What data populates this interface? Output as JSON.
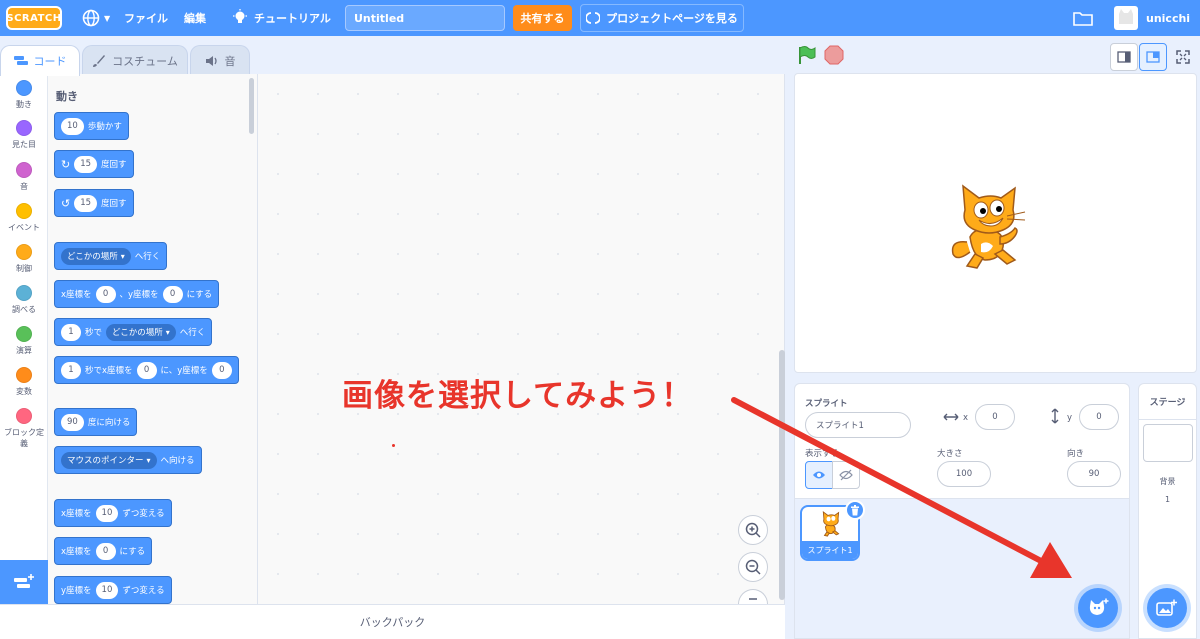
{
  "menubar": {
    "logo": "SCRATCH",
    "file": "ファイル",
    "edit": "編集",
    "tutorials": "チュートリアル",
    "project_title": "Untitled",
    "share": "共有する",
    "see_project_page": "プロジェクトページを見る",
    "username": "unicchi"
  },
  "tabs": {
    "code": "コード",
    "costumes": "コスチューム",
    "sounds": "音"
  },
  "categories": [
    {
      "label": "動き",
      "color": "#4c97ff"
    },
    {
      "label": "見た目",
      "color": "#9966ff"
    },
    {
      "label": "音",
      "color": "#cf63cf"
    },
    {
      "label": "イベント",
      "color": "#ffbf00"
    },
    {
      "label": "制御",
      "color": "#ffab19"
    },
    {
      "label": "調べる",
      "color": "#5cb1d6"
    },
    {
      "label": "演算",
      "color": "#59c059"
    },
    {
      "label": "変数",
      "color": "#ff8c1a"
    },
    {
      "label": "ブロック定義",
      "color": "#ff6680"
    }
  ],
  "palette": {
    "heading": "動き",
    "move": {
      "v": "10",
      "t": "歩動かす"
    },
    "turn_right": {
      "v": "15",
      "t": "度回す"
    },
    "turn_left": {
      "v": "15",
      "t": "度回す"
    },
    "goto": {
      "d": "どこかの場所",
      "t": "へ行く"
    },
    "goto_xy": {
      "a": "x座標を",
      "x": "0",
      "b": "、y座標を",
      "y": "0",
      "c": "にする"
    },
    "glide": {
      "v": "1",
      "a": "秒で",
      "d": "どこかの場所",
      "t": "へ行く"
    },
    "glide_xy": {
      "v": "1",
      "a": "秒でx座標を",
      "x": "0",
      "b": "に、y座標を",
      "y": "0"
    },
    "point_dir": {
      "v": "90",
      "t": "度に向ける"
    },
    "point_towards": {
      "d": "マウスのポインター",
      "t": "へ向ける"
    },
    "change_x": {
      "a": "x座標を",
      "v": "10",
      "t": "ずつ変える"
    },
    "set_x": {
      "a": "x座標を",
      "v": "0",
      "t": "にする"
    },
    "change_y": {
      "a": "y座標を",
      "v": "10",
      "t": "ずつ変える"
    }
  },
  "annotation": "画像を選択してみよう！",
  "backpack": "バックパック",
  "sprite_info": {
    "sprite_label": "スプライト",
    "sprite_name": "スプライト1",
    "x_label": "x",
    "x_value": "0",
    "y_label": "y",
    "y_value": "0",
    "show_label": "表示する",
    "size_label": "大きさ",
    "size_value": "100",
    "direction_label": "向き",
    "direction_value": "90"
  },
  "sprite_list": [
    {
      "name": "スプライト1"
    }
  ],
  "stage_panel": {
    "title": "ステージ",
    "backdrops_label": "背景",
    "backdrops_count": "1"
  },
  "colors": {
    "accent": "#4c97ff",
    "share": "#ff8c1a",
    "annotation": "#e8352b"
  }
}
